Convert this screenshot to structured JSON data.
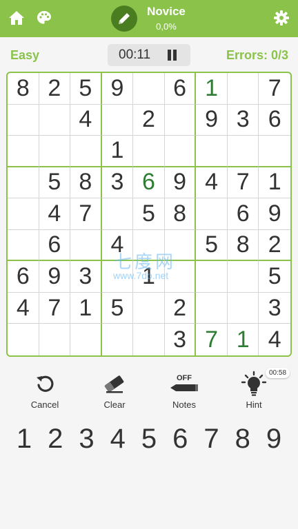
{
  "header": {
    "level_title": "Novice",
    "level_progress": "0,0%",
    "icons": {
      "home": "home-icon",
      "palette": "palette-icon",
      "pencil": "pencil-icon",
      "settings": "gear-icon"
    },
    "colors": {
      "bar": "#8bc34a",
      "accent_dark": "#4a7d1f"
    }
  },
  "status": {
    "difficulty": "Easy",
    "timer": "00:11",
    "errors": "Errors: 0/3"
  },
  "grid": {
    "cells": [
      [
        "8",
        "2",
        "5",
        "9",
        "",
        "6",
        "1",
        "",
        "7"
      ],
      [
        "",
        "",
        "4",
        "",
        "2",
        "",
        "9",
        "3",
        "6"
      ],
      [
        "",
        "",
        "",
        "1",
        "",
        "",
        "",
        "",
        ""
      ],
      [
        "",
        "5",
        "8",
        "3",
        "6",
        "9",
        "4",
        "7",
        "1"
      ],
      [
        "",
        "4",
        "7",
        "",
        "5",
        "8",
        "",
        "6",
        "9"
      ],
      [
        "",
        "6",
        "",
        "4",
        "",
        "",
        "5",
        "8",
        "2"
      ],
      [
        "6",
        "9",
        "3",
        "",
        "1",
        "",
        "",
        "",
        "5"
      ],
      [
        "4",
        "7",
        "1",
        "5",
        "",
        "2",
        "",
        "",
        "3"
      ],
      [
        "",
        "",
        "",
        "",
        "",
        "3",
        "7",
        "1",
        "4"
      ]
    ],
    "user_entered": [
      [
        0,
        6
      ],
      [
        3,
        4
      ],
      [
        8,
        6
      ],
      [
        8,
        7
      ]
    ],
    "colors": {
      "given": "#333333",
      "user": "#2e7d32",
      "box_border": "#8bc34a"
    }
  },
  "watermark": {
    "text": "七度网",
    "url": "www.7do.net"
  },
  "tools": {
    "cancel_label": "Cancel",
    "clear_label": "Clear",
    "notes_label": "Notes",
    "notes_state": "OFF",
    "hint_label": "Hint",
    "hint_timer": "00:58"
  },
  "numpad": [
    "1",
    "2",
    "3",
    "4",
    "5",
    "6",
    "7",
    "8",
    "9"
  ]
}
